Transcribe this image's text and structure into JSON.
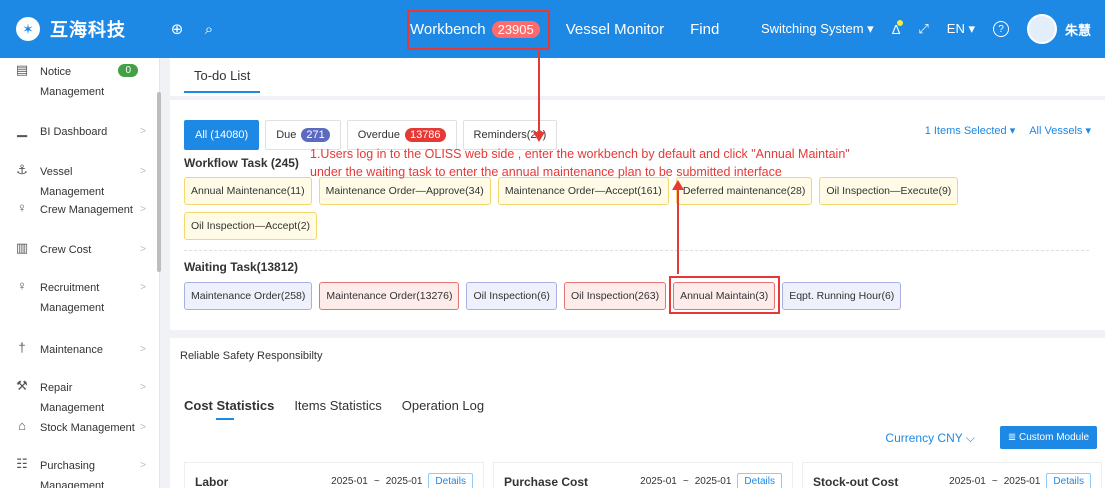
{
  "brand": {
    "logo": "✶",
    "name": "互海科技"
  },
  "top": {
    "collapse_icon": "⊕",
    "search_icon": "⌕",
    "nav": [
      {
        "label": "Workbench",
        "badge": "23905"
      },
      {
        "label": "Vessel Monitor"
      },
      {
        "label": "Find"
      }
    ],
    "switching_system": "Switching System ▾",
    "bell_icon": "Δ",
    "expand_icon": "⤢",
    "language": "EN ▾",
    "help_icon": "?",
    "user_name": "朱慧"
  },
  "sidebar": {
    "items": [
      {
        "icon": "▤",
        "label": "Notice Management",
        "badge": "0"
      },
      {
        "icon": "▁",
        "label": "BI Dashboard"
      },
      {
        "icon": "⚓",
        "label": "Vessel Management"
      },
      {
        "icon": "♀",
        "label": "Crew Management"
      },
      {
        "icon": "▥",
        "label": "Crew Cost"
      },
      {
        "icon": "♀",
        "label": "Recruitment Management"
      },
      {
        "icon": "†",
        "label": "Maintenance"
      },
      {
        "icon": "⚒",
        "label": "Repair Management"
      },
      {
        "icon": "⌂",
        "label": "Stock Management"
      },
      {
        "icon": "☷",
        "label": "Purchasing Management"
      }
    ],
    "arrow": ">"
  },
  "main": {
    "tab": "To-do List",
    "filters": {
      "all": "All (14080)",
      "due": "Due",
      "due_count": "271",
      "overdue": "Overdue",
      "overdue_count": "13786",
      "reminders": "Reminders(23)"
    },
    "items_selected": "1 Items Selected ▾",
    "all_vessels": "All Vessels ▾",
    "workflow_title": "Workflow Task (245)",
    "workflow_chips": [
      "Annual Maintenance(11)",
      "Maintenance Order—Approve(34)",
      "Maintenance Order—Accept(161)",
      "Deferred maintenance(28)",
      "Oil Inspection—Execute(9)",
      "Oil Inspection—Accept(2)"
    ],
    "waiting_title": "Waiting Task(13812)",
    "waiting_chips": [
      {
        "label": "Maintenance Order(258)",
        "tone": "purple"
      },
      {
        "label": "Maintenance Order(13276)",
        "tone": "red"
      },
      {
        "label": "Oil Inspection(6)",
        "tone": "purple"
      },
      {
        "label": "Oil Inspection(263)",
        "tone": "red"
      },
      {
        "label": "Annual Maintain(3)",
        "tone": "red"
      },
      {
        "label": "Eqpt. Running Hour(6)",
        "tone": "purple"
      }
    ],
    "annotation_line1": "1.Users log in to the OLISS web side , enter the workbench by default and click \"Annual Maintain\"",
    "annotation_line2": "under the waiting task to enter the annual maintenance plan to be submitted interface",
    "safety": "Reliable Safety Responsibilty",
    "stat_tabs": [
      "Cost Statistics",
      "Items Statistics",
      "Operation Log"
    ],
    "currency": "Currency CNY ⌵",
    "custom_module": "≣ Custom Module",
    "stat_cards": [
      {
        "title": "Labor",
        "from": "2025-01",
        "to": "2025-01",
        "details": "Details"
      },
      {
        "title": "Purchase Cost",
        "from": "2025-01",
        "to": "2025-01",
        "details": "Details"
      },
      {
        "title": "Stock-out Cost",
        "from": "2025-01",
        "to": "2025-01",
        "details": "Details"
      }
    ],
    "date_sep": "~"
  }
}
